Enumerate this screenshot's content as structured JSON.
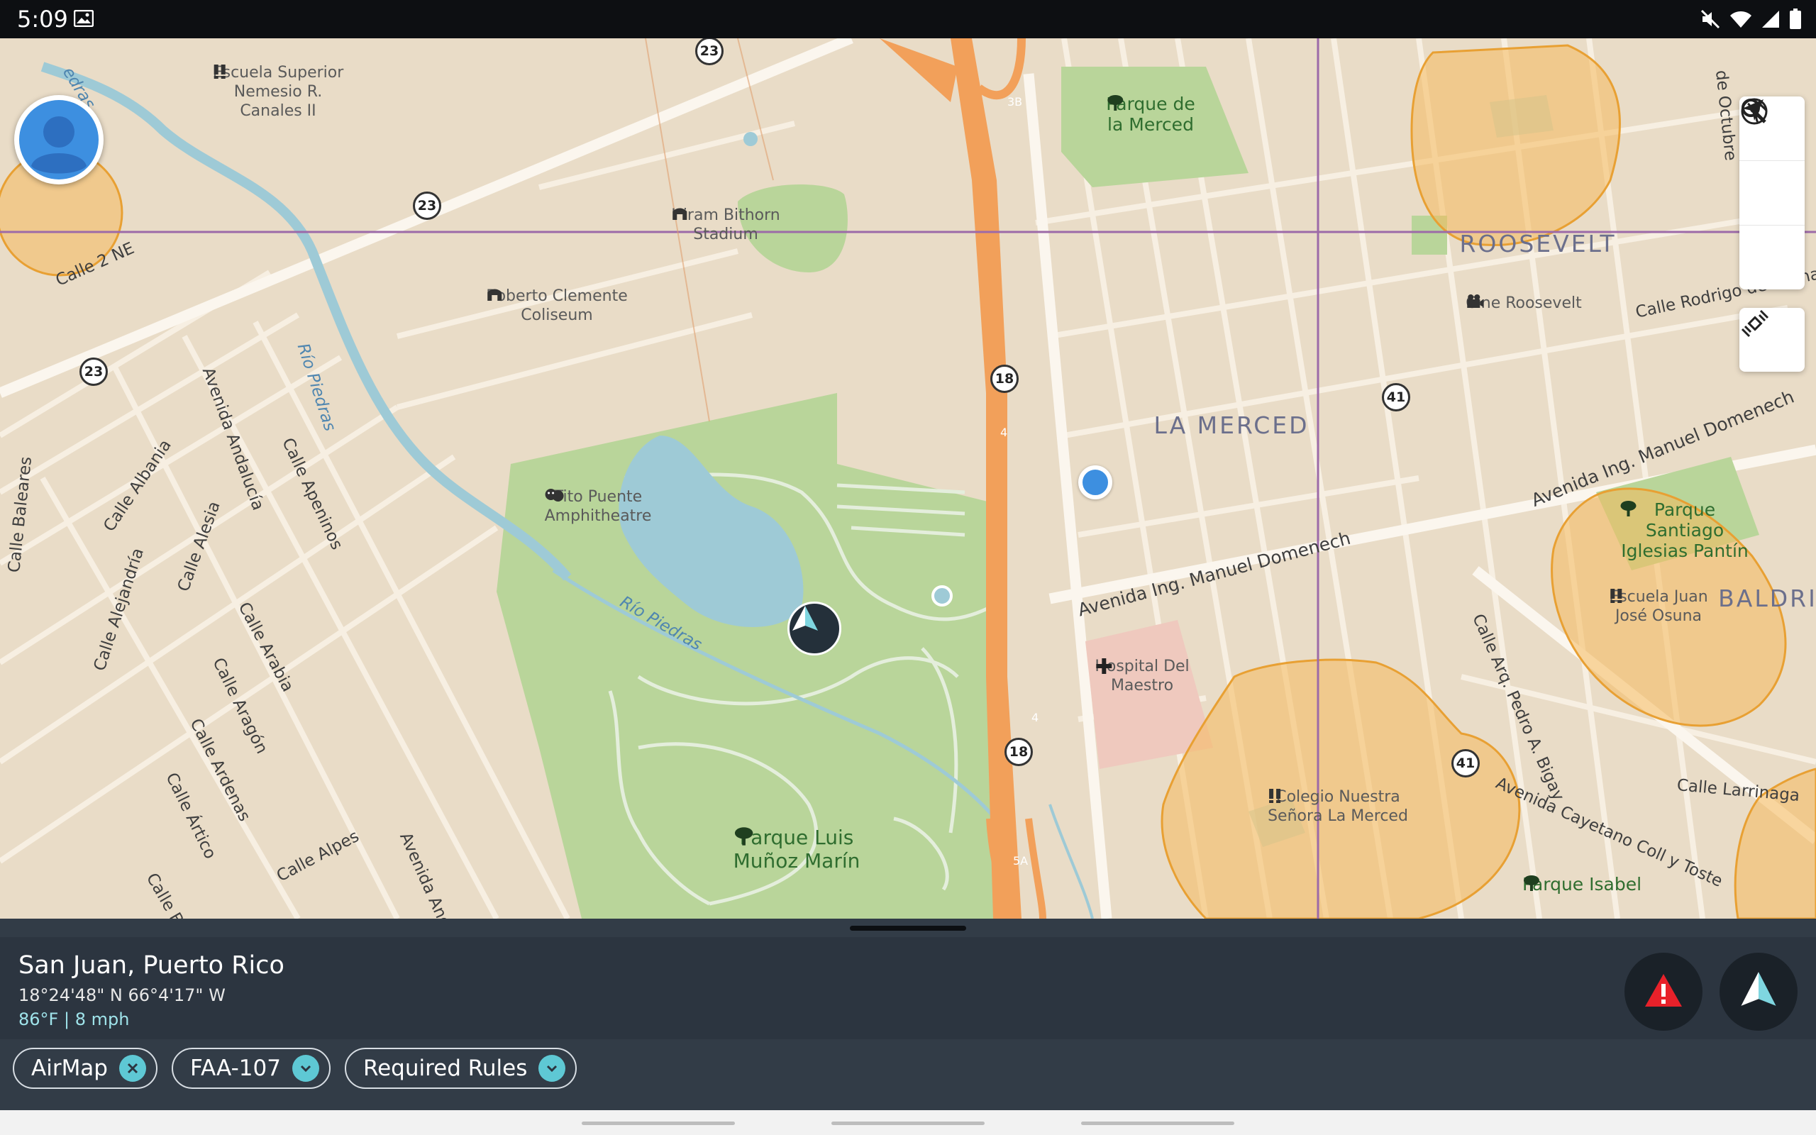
{
  "status_bar": {
    "time": "5:09"
  },
  "map": {
    "pois": [
      {
        "name": "Escuela Superior\nNemesio R.\nCanales II",
        "type": "school"
      },
      {
        "name": "Hiram Bithorn\nStadium",
        "type": "stadium"
      },
      {
        "name": "Roberto Clemente\nColiseum",
        "type": "stadium"
      },
      {
        "name": "Tito Puente\nAmphitheatre",
        "type": "theatre"
      },
      {
        "name": "Parque de\nla Merced",
        "type": "park"
      },
      {
        "name": "Cine Roosevelt",
        "type": "cinema"
      },
      {
        "name": "Parque Santiago\nIglesias Pantín",
        "type": "park"
      },
      {
        "name": "Escuela Juan\nJosé Osuna",
        "type": "school"
      },
      {
        "name": "Hospital Del\nMaestro",
        "type": "hospital"
      },
      {
        "name": "Colegio Nuestra\nSeñora La Merced",
        "type": "school"
      },
      {
        "name": "Parque Luis\nMuñoz Marín",
        "type": "park"
      },
      {
        "name": "Parque Isabel",
        "type": "park"
      }
    ],
    "districts": [
      "LA MERCED",
      "ROOSEVELT",
      "BALDRI"
    ],
    "streets": [
      "Calle 2 NE",
      "Río Piedras",
      "Río Piedras",
      "Avenida Andalucía",
      "Calle Apeninos",
      "Calle Albania",
      "Calle Baleares",
      "Calle Alesia",
      "Calle Alejandría",
      "Calle Arabia",
      "Calle Aragón",
      "Calle Ardenas",
      "Calle Ártico",
      "Calle Alpes",
      "Avenida Andalucía",
      "Calle Baleares",
      "Avenida Ing. Manuel Domenech",
      "Avenida Ing. Manuel Domenech",
      "Calle Rodrigo de Triana",
      "Calle Arq. Pedro A. Bigay",
      "Avenida Cayetano Coll y Toste",
      "Calle Larrinaga",
      "de Octubre",
      "edras"
    ],
    "route_shields": [
      "23",
      "23",
      "23",
      "18",
      "18",
      "41",
      "41"
    ],
    "highway_marks": [
      "3B",
      "4",
      "4",
      "5A"
    ]
  },
  "panel": {
    "location": "San Juan, Puerto Rico",
    "coordinates": "18°24'48\" N  66°4'17\" W",
    "weather": "86°F | 8 mph",
    "chips": [
      {
        "label": "AirMap",
        "icon": "close-icon"
      },
      {
        "label": "FAA-107",
        "icon": "chevron-down-icon"
      },
      {
        "label": "Required Rules",
        "icon": "chevron-down-icon"
      }
    ]
  },
  "colors": {
    "land": "#E9DCC7",
    "park": "#B9D59A",
    "water": "#9ECAD6",
    "highway": "#F2A05A",
    "airspace_fill": "#F6B95C",
    "panel": "#323C47",
    "accent": "#5EC8D4",
    "warning": "#E8212A"
  }
}
